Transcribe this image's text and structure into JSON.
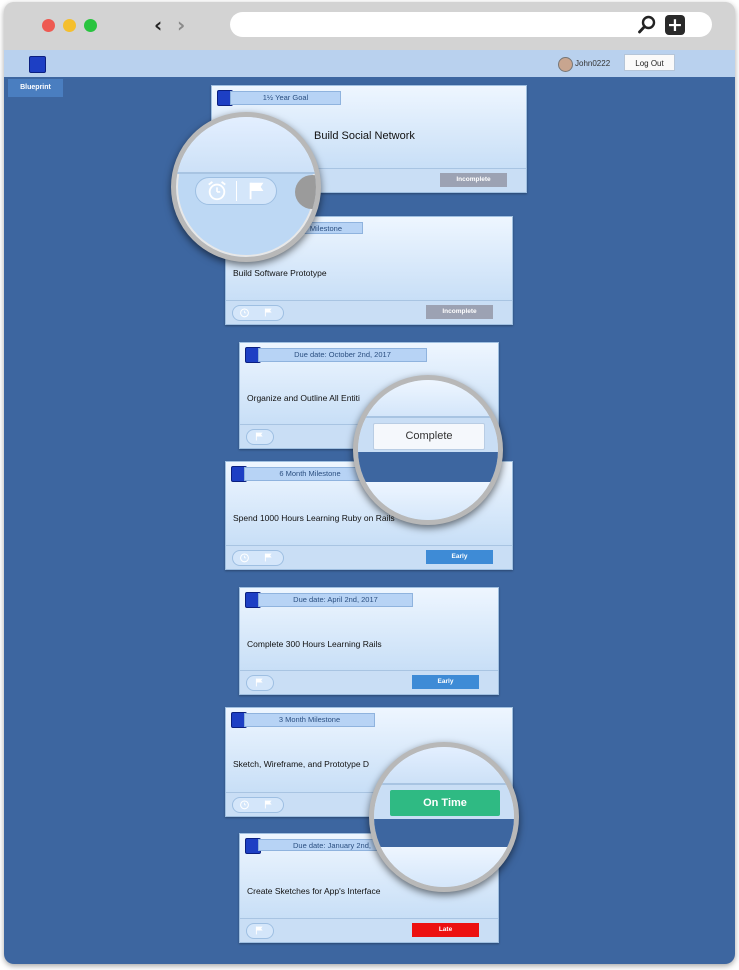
{
  "header": {
    "username": "John0222",
    "logout_label": "Log Out",
    "nav_tab": "Blueprint"
  },
  "cards": [
    {
      "label": "1½ Year Goal",
      "title": "Build Social Network",
      "status": "Incomplete"
    },
    {
      "label": "Milestone",
      "title": "Build Software Prototype",
      "status": "Incomplete"
    },
    {
      "label": "Due date: October 2nd, 2017",
      "title": "Organize and Outline All Entiti"
    },
    {
      "label": "6 Month Milestone",
      "title": "Spend 1000 Hours Learning Ruby on Rails",
      "status": "Early"
    },
    {
      "label": "Due date: April 2nd, 2017",
      "title": "Complete 300 Hours Learning Rails",
      "status": "Early"
    },
    {
      "label": "3 Month Milestone",
      "title": "Sketch, Wireframe, and Prototype D"
    },
    {
      "label": "Due date: January 2nd,",
      "title": "Create Sketches for App's Interface",
      "status": "Late"
    }
  ],
  "zoom": {
    "complete_label": "Complete",
    "on_time_label": "On Time"
  },
  "colors": {
    "background": "#3d66a0",
    "early": "#3e8bd6",
    "late": "#ec1010",
    "on_time": "#2fba83",
    "incomplete": "#9ca2b3"
  }
}
